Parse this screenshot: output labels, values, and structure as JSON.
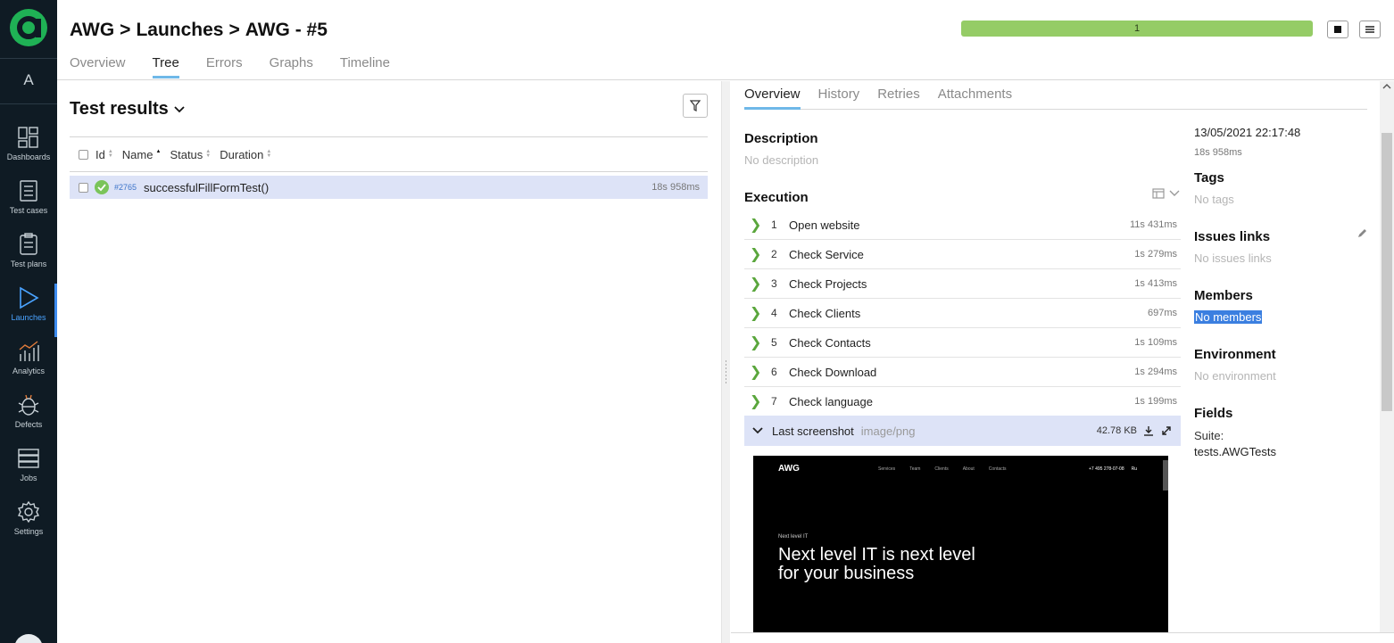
{
  "sidebar": {
    "user_initial": "A",
    "items": [
      {
        "label": "Dashboards"
      },
      {
        "label": "Test cases"
      },
      {
        "label": "Test plans"
      },
      {
        "label": "Launches"
      },
      {
        "label": "Analytics"
      },
      {
        "label": "Defects"
      },
      {
        "label": "Jobs"
      },
      {
        "label": "Settings"
      }
    ]
  },
  "header": {
    "breadcrumb": [
      "AWG",
      ">",
      "Launches",
      ">",
      "AWG - #5"
    ],
    "tabs": [
      "Overview",
      "Tree",
      "Errors",
      "Graphs",
      "Timeline"
    ],
    "active_tab": "Tree",
    "progress_label": "1",
    "progress_color": "#95cc66"
  },
  "results": {
    "title": "Test results",
    "columns": [
      "Id",
      "Name",
      "Status",
      "Duration"
    ],
    "rows": [
      {
        "id": "#2765",
        "name": "successfulFillFormTest()",
        "duration": "18s 958ms"
      }
    ]
  },
  "detail": {
    "tabs": [
      "Overview",
      "History",
      "Retries",
      "Attachments"
    ],
    "active_tab": "Overview",
    "description_title": "Description",
    "description_value": "No description",
    "execution_title": "Execution",
    "steps": [
      {
        "num": "1",
        "name": "Open website",
        "duration": "11s 431ms"
      },
      {
        "num": "2",
        "name": "Check Service",
        "duration": "1s 279ms"
      },
      {
        "num": "3",
        "name": "Check Projects",
        "duration": "1s 413ms"
      },
      {
        "num": "4",
        "name": "Check Clients",
        "duration": "697ms"
      },
      {
        "num": "5",
        "name": "Check Contacts",
        "duration": "1s 109ms"
      },
      {
        "num": "6",
        "name": "Check Download",
        "duration": "1s 294ms"
      },
      {
        "num": "7",
        "name": "Check language",
        "duration": "1s 199ms"
      }
    ],
    "attachment": {
      "name": "Last screenshot",
      "type": "image/png",
      "size": "42.78 KB"
    },
    "screenshot": {
      "logo": "AWG",
      "nav": [
        "Services",
        "Team",
        "Clients",
        "About",
        "Contacts"
      ],
      "phone": "+7 495 278-07-08",
      "lang": "Ru",
      "kicker": "Next level IT",
      "headline_1": "Next level IT is next level",
      "headline_2": "for your business"
    },
    "meta": {
      "date": "13/05/2021 22:17:48",
      "duration": "18s 958ms",
      "tags_title": "Tags",
      "tags_value": "No tags",
      "issues_title": "Issues links",
      "issues_value": "No issues links",
      "members_title": "Members",
      "members_value": "No members",
      "env_title": "Environment",
      "env_value": "No environment",
      "fields_title": "Fields",
      "suite_label": "Suite:",
      "suite_value": "tests.AWGTests"
    }
  }
}
